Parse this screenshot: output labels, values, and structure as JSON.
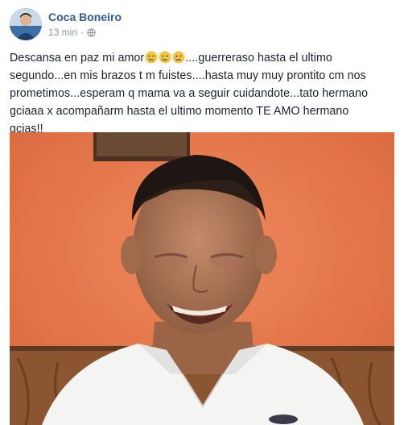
{
  "post": {
    "author": "Coca Boneiro",
    "timestamp": "13 min",
    "separator": "·",
    "privacy_icon": "globe-icon",
    "text_lines": [
      {
        "before": "Descansa en paz mi amor",
        "after": "....guerreraso hasta el ultimo"
      },
      {
        "text": "segundo...en mis brazos t m fuistes....hasta muy muy prontito cm nos"
      },
      {
        "text": "prometimos...esperam q mama va a seguir cuidandote...tato hermano"
      },
      {
        "text": "gciaaa x acompañarm hasta el ultimo momento TE AMO hermano"
      },
      {
        "text": "gcias!!"
      }
    ],
    "emoji_icon": "sad-face-emoji-icon",
    "emoji_count": 3
  },
  "colors": {
    "author_link": "#365899",
    "meta_text": "#90949c",
    "body_text": "#1d2129",
    "photo_wall": "#e77a4e",
    "emoji_fill": "#f4c542"
  }
}
